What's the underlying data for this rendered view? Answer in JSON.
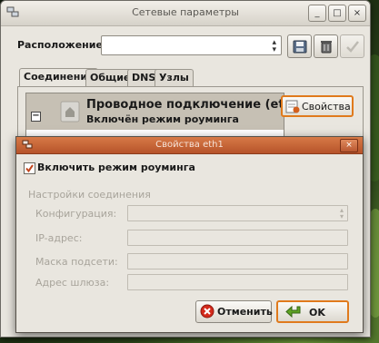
{
  "main_window": {
    "title": "Сетевые параметры",
    "controls": {
      "minimize": "_",
      "maximize": "□",
      "close": "×"
    },
    "location_label": "Расположение:",
    "location_value": "",
    "tabs": [
      {
        "label": "Соединения",
        "active": true
      },
      {
        "label": "Общие",
        "active": false
      },
      {
        "label": "DNS",
        "active": false
      },
      {
        "label": "Узлы",
        "active": false
      }
    ],
    "connection": {
      "expander": "−",
      "title": "Проводное подключение (et...",
      "subtitle": "Включён режим роуминга"
    },
    "properties_button": "Свойства"
  },
  "dialog": {
    "title": "Свойства eth1",
    "close": "×",
    "roaming_checkbox": {
      "label": "Включить режим роуминга",
      "checked": true
    },
    "settings_group": "Настройки соединения",
    "fields": [
      {
        "label": "Конфигурация:",
        "value": ""
      },
      {
        "label": "IP-адрес:",
        "value": ""
      },
      {
        "label": "Маска подсети:",
        "value": ""
      },
      {
        "label": "Адрес шлюза:",
        "value": ""
      }
    ],
    "cancel_button": "Отменить",
    "ok_button": "OK"
  },
  "colors": {
    "accent": "#e07a1c",
    "dialog_titlebar": "#c4643a",
    "selection": "#c6c0b4"
  },
  "icons": [
    "network-icon",
    "save-icon",
    "delete-icon",
    "check-icon",
    "wired-connection-icon",
    "properties-icon",
    "cancel-icon",
    "ok-arrow-icon"
  ]
}
